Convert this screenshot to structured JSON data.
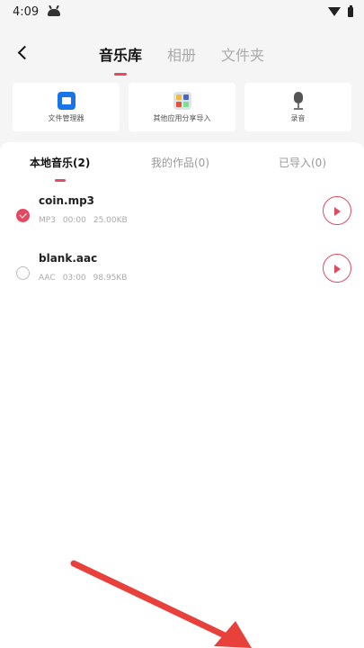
{
  "status_bar": {
    "time": "4:09"
  },
  "header": {
    "tabs": [
      {
        "label": "音乐库"
      },
      {
        "label": "相册"
      },
      {
        "label": "文件夹"
      }
    ]
  },
  "import_cards": [
    {
      "label": "文件管理器",
      "icon": "folder-icon"
    },
    {
      "label": "其他应用分享导入",
      "icon": "apps-icon"
    },
    {
      "label": "录音",
      "icon": "microphone-icon"
    }
  ],
  "sub_tabs": [
    {
      "label": "本地音乐(2)"
    },
    {
      "label": "我的作品(0)"
    },
    {
      "label": "已导入(0)"
    }
  ],
  "files": [
    {
      "name": "coin.mp3",
      "format": "MP3",
      "duration": "00:00",
      "size": "25.00KB",
      "selected": true
    },
    {
      "name": "blank.aac",
      "format": "AAC",
      "duration": "03:00",
      "size": "98.95KB",
      "selected": false
    }
  ],
  "colors": {
    "accent": "#e24a62",
    "arrow": "#e8413b"
  }
}
